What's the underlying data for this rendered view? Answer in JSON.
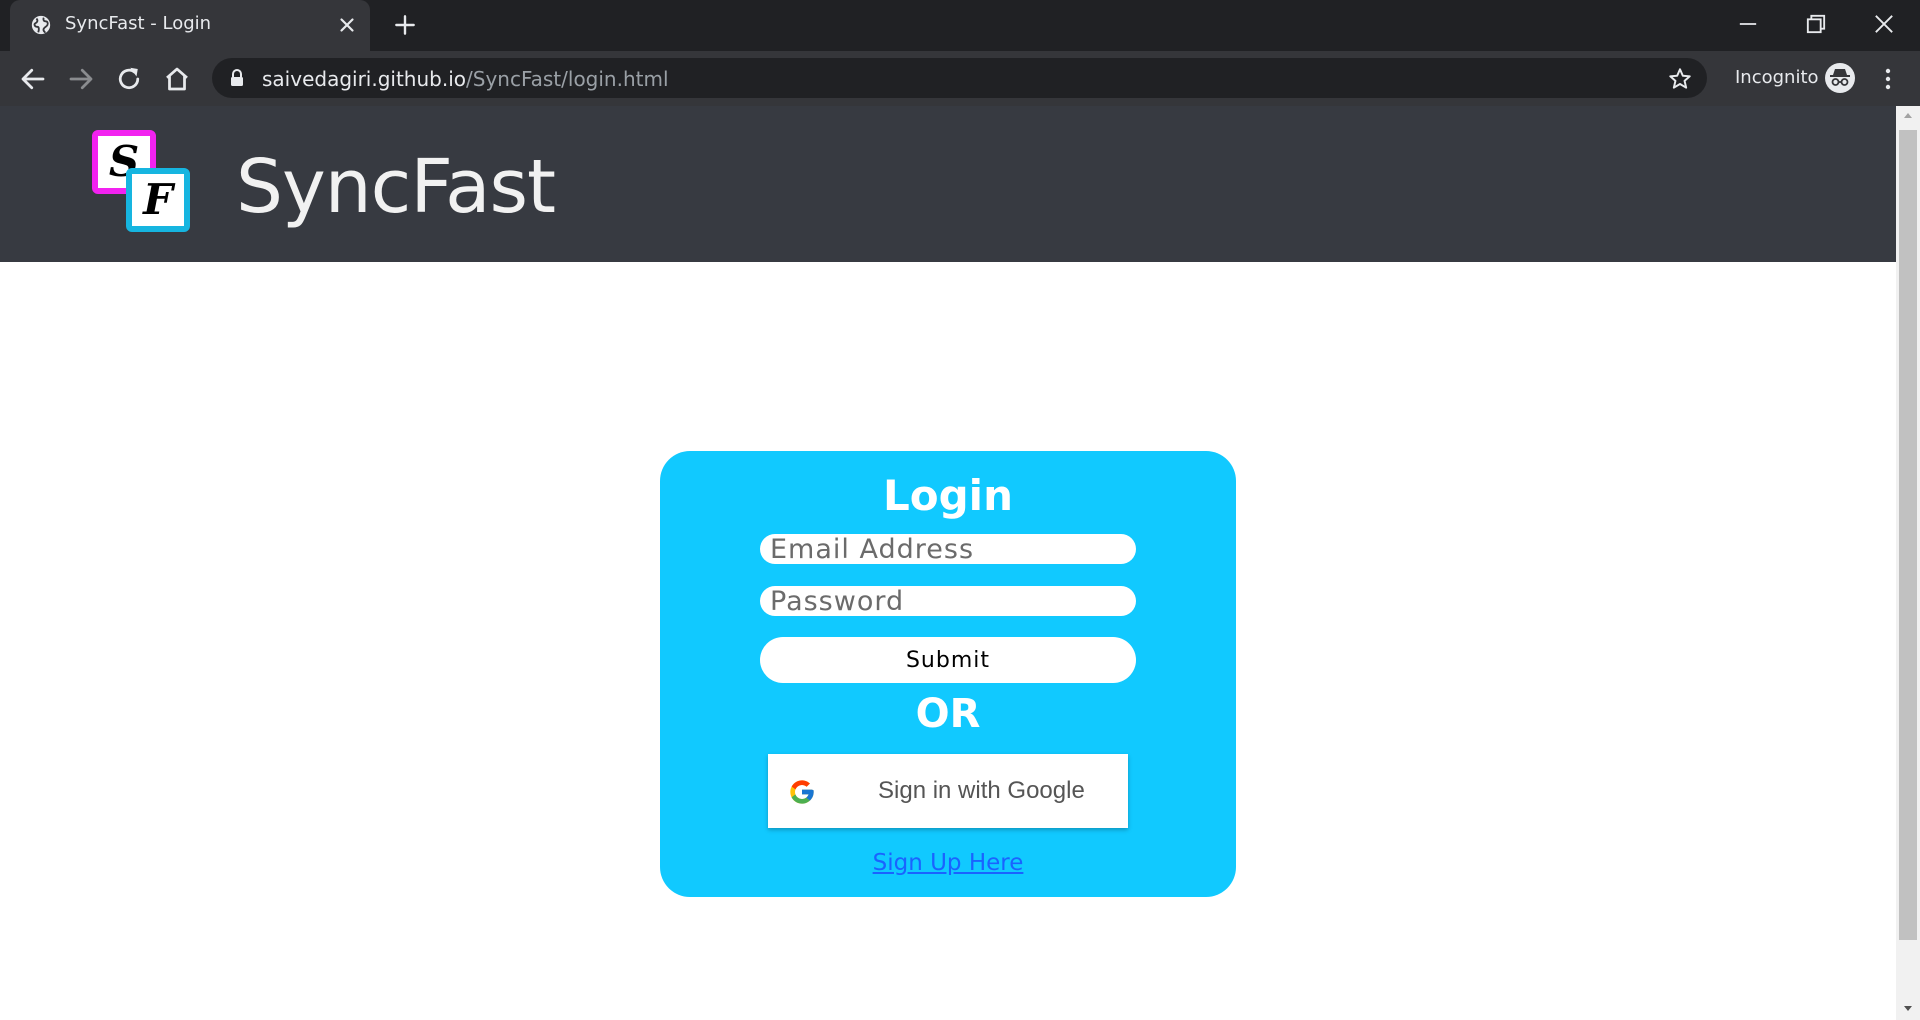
{
  "browser": {
    "tab_title": "SyncFast - Login",
    "url_host": "saivedagiri.github.io",
    "url_path": "/SyncFast/login.html",
    "incognito_label": "Incognito"
  },
  "site": {
    "brand": "SyncFast",
    "logo_letter_1": "S",
    "logo_letter_2": "F"
  },
  "login": {
    "title": "Login",
    "email_placeholder": "Email Address",
    "password_placeholder": "Password",
    "submit_label": "Submit",
    "or_label": "OR",
    "google_label": "Sign in with Google",
    "signup_label": "Sign Up Here"
  },
  "colors": {
    "header_bg": "#373a41",
    "card_bg": "#11c9ff",
    "logo_magenta": "#f222f0",
    "logo_cyan": "#16b5e0",
    "link": "#1a63ff"
  },
  "icons": [
    "globe-icon",
    "close-icon",
    "plus-icon",
    "minimize-icon",
    "restore-icon",
    "back-icon",
    "forward-icon",
    "reload-icon",
    "home-icon",
    "lock-icon",
    "star-icon",
    "incognito-icon",
    "kebab-icon",
    "google-icon"
  ]
}
